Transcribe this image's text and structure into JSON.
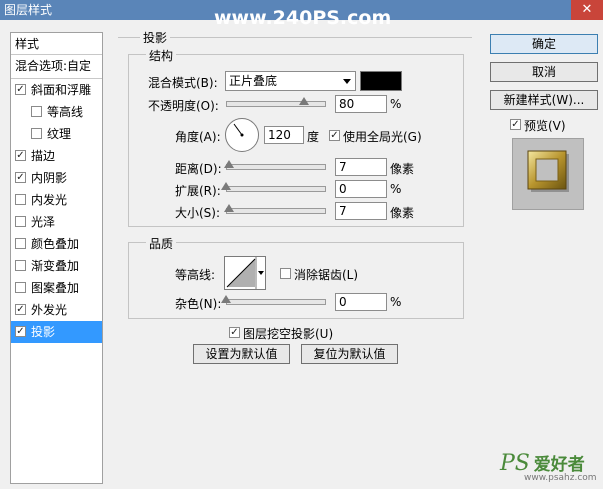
{
  "window": {
    "title": "图层样式",
    "close": "✕",
    "watermark": "www.240PS.com"
  },
  "left_panel": {
    "header": "样式",
    "blend_options": "混合选项:自定",
    "items": [
      {
        "label": "斜面和浮雕",
        "checked": true,
        "indent": false
      },
      {
        "label": "等高线",
        "checked": false,
        "indent": true
      },
      {
        "label": "纹理",
        "checked": false,
        "indent": true
      },
      {
        "label": "描边",
        "checked": true,
        "indent": false
      },
      {
        "label": "内阴影",
        "checked": true,
        "indent": false
      },
      {
        "label": "内发光",
        "checked": false,
        "indent": false
      },
      {
        "label": "光泽",
        "checked": false,
        "indent": false
      },
      {
        "label": "颜色叠加",
        "checked": false,
        "indent": false
      },
      {
        "label": "渐变叠加",
        "checked": false,
        "indent": false
      },
      {
        "label": "图案叠加",
        "checked": false,
        "indent": false
      },
      {
        "label": "外发光",
        "checked": true,
        "indent": false
      },
      {
        "label": "投影",
        "checked": true,
        "indent": false,
        "selected": true
      }
    ]
  },
  "main": {
    "section_title": "投影",
    "structure": {
      "title": "结构",
      "blend_mode_label": "混合模式(B):",
      "blend_mode_value": "正片叠底",
      "opacity_label": "不透明度(O):",
      "opacity_value": "80",
      "opacity_fraction": 0.8,
      "percent": "%",
      "angle_label": "角度(A):",
      "angle_value": "120",
      "angle_unit": "度",
      "global_light_label": "使用全局光(G)",
      "global_light_checked": true,
      "distance_label": "距离(D):",
      "distance_value": "7",
      "distance_fraction": 0.03,
      "spread_label": "扩展(R):",
      "spread_value": "0",
      "spread_fraction": 0.0,
      "size_label": "大小(S):",
      "size_value": "7",
      "size_fraction": 0.03,
      "px_unit": "像素"
    },
    "quality": {
      "title": "品质",
      "contour_label": "等高线:",
      "anti_alias_label": "消除锯齿(L)",
      "anti_alias_checked": false,
      "noise_label": "杂色(N):",
      "noise_value": "0",
      "noise_fraction": 0.0,
      "percent": "%"
    },
    "knockout_label": "图层挖空投影(U)",
    "knockout_checked": true,
    "set_default": "设置为默认值",
    "reset_default": "复位为默认值"
  },
  "right_panel": {
    "ok": "确定",
    "cancel": "取消",
    "new_style": "新建样式(W)...",
    "preview_label": "预览(V)",
    "preview_checked": true
  },
  "logo": {
    "ps": "PS",
    "text": "爱好者",
    "url": "www.psahz.com"
  },
  "colors": {
    "titlebar": "#5a85b8",
    "selected": "#3399ff",
    "swatch": "#000000"
  }
}
